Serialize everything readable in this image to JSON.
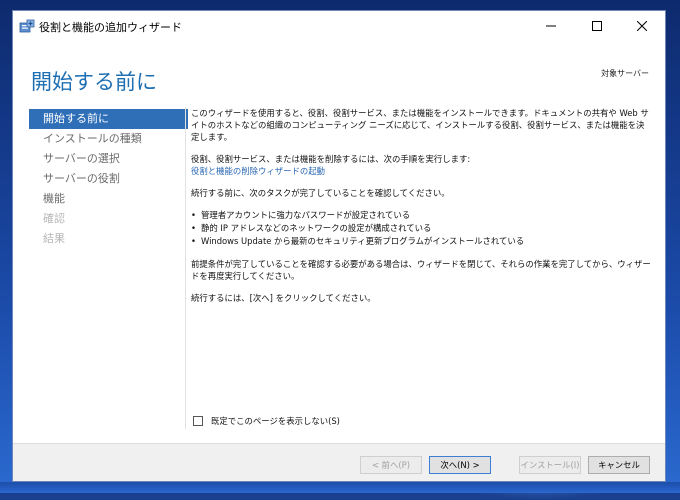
{
  "window": {
    "title": "役割と機能の追加ウィザード",
    "icon": "server-manager-icon",
    "controls": {
      "minimize": "minimize-icon",
      "maximize": "maximize-icon",
      "close": "close-icon"
    }
  },
  "header": {
    "page_title": "開始する前に",
    "target_server_label": "対象サーバー"
  },
  "sidebar": {
    "items": [
      {
        "label": "開始する前に",
        "state": "active"
      },
      {
        "label": "インストールの種類",
        "state": "normal"
      },
      {
        "label": "サーバーの選択",
        "state": "normal"
      },
      {
        "label": "サーバーの役割",
        "state": "normal"
      },
      {
        "label": "機能",
        "state": "normal"
      },
      {
        "label": "確認",
        "state": "disabled"
      },
      {
        "label": "結果",
        "state": "disabled"
      }
    ]
  },
  "content": {
    "intro": "このウィザードを使用すると、役割、役割サービス、または機能をインストールできます。ドキュメントの共有や Web サイトのホストなどの組織のコンピューティング ニーズに応じて、インストールする役割、役割サービス、または機能を決定します。",
    "remove_text": "役割、役割サービス、または機能を削除するには、次の手順を実行します:",
    "remove_link": "役割と機能の削除ウィザードの起動",
    "tasks_intro": "続行する前に、次のタスクが完了していることを確認してください。",
    "tasks": [
      "管理者アカウントに強力なパスワードが設定されている",
      "静的 IP アドレスなどのネットワークの設定が構成されている",
      "Windows Update から最新のセキュリティ更新プログラムがインストールされている"
    ],
    "prereq_text": "前提条件が完了していることを確認する必要がある場合は、ウィザードを閉じて、それらの作業を完了してから、ウィザードを再度実行してください。",
    "continue_text": "続行するには、[次へ] をクリックしてください。",
    "skip_label": "既定でこのページを表示しない(S)"
  },
  "footer": {
    "prev_label": "< 前へ(P)",
    "next_label": "次へ(N) >",
    "install_label": "インストール(I)",
    "cancel_label": "キャンセル"
  },
  "colors": {
    "accent": "#2e6fb8",
    "title_blue": "#1e6fb3",
    "link": "#2a67b3"
  }
}
